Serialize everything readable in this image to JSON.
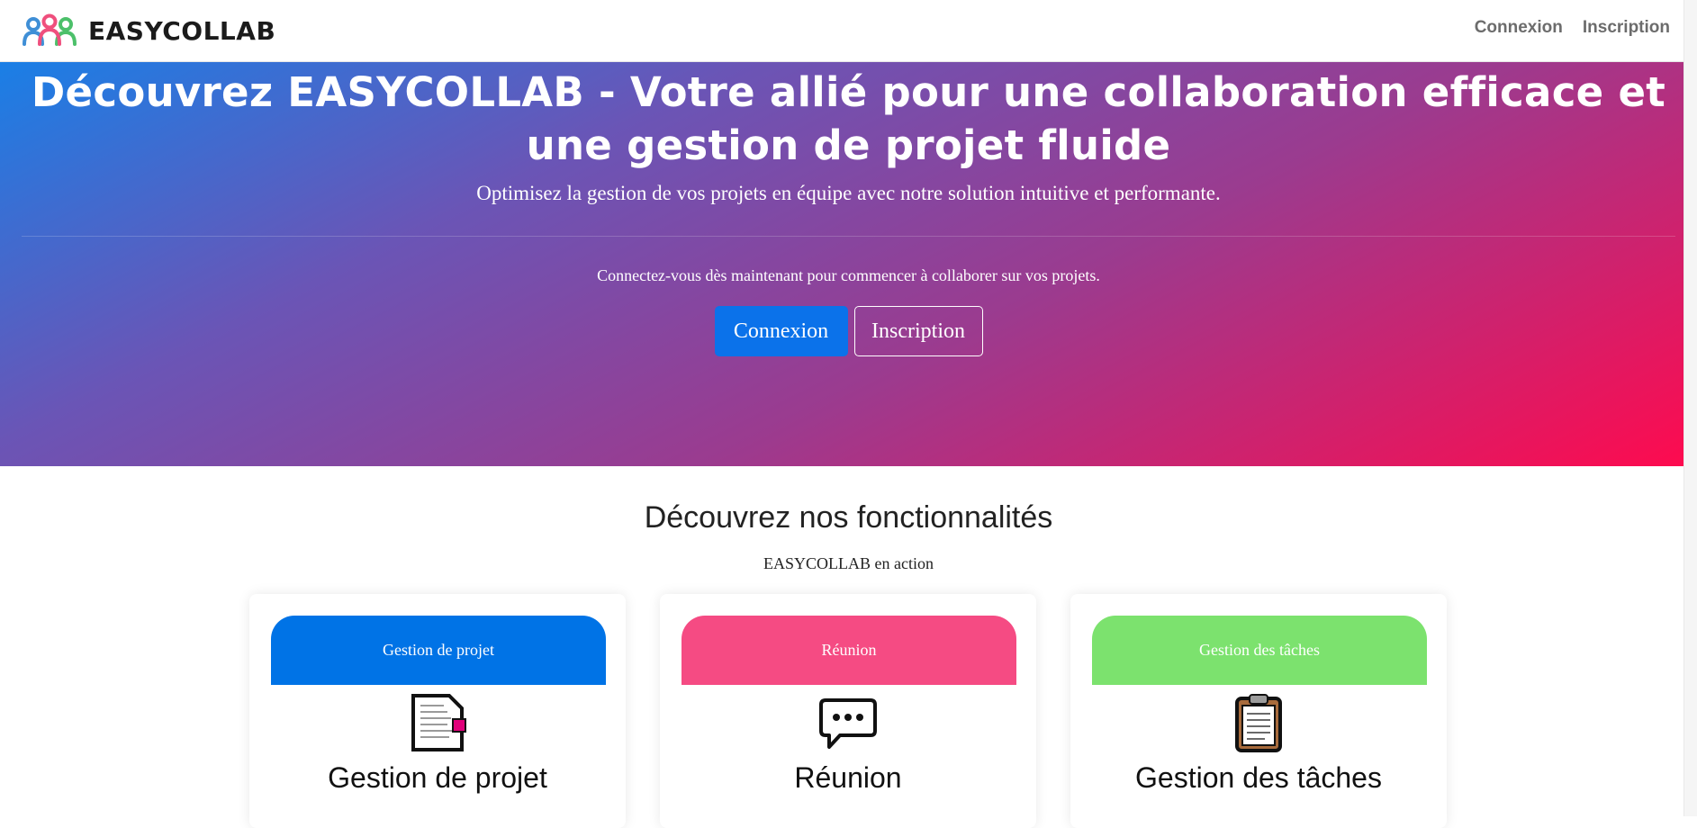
{
  "navbar": {
    "brand": "EASYCOLLAB",
    "logo_icon": "team-people-icon",
    "links": [
      "Connexion",
      "Inscription"
    ]
  },
  "hero": {
    "title": "Découvrez EASYCOLLAB - Votre allié pour une collaboration efficace et une gestion de projet fluide",
    "subtitle": "Optimisez la gestion de vos projets en équipe avec notre solution intuitive et performante.",
    "cta_text": "Connectez-vous dès maintenant pour commencer à collaborer sur vos projets.",
    "login_button": "Connexion",
    "signup_button": "Inscription",
    "gradient": [
      "#1a7fe6",
      "#6a55b6",
      "#9b3b8f",
      "#ff0a4e"
    ]
  },
  "features": {
    "title": "Découvrez nos fonctionnalités",
    "subtitle": "EASYCOLLAB en action",
    "cards": [
      {
        "header": "Gestion de projet",
        "title": "Gestion de projet",
        "icon": "document-icon",
        "color": "#0073e6"
      },
      {
        "header": "Réunion",
        "title": "Réunion",
        "icon": "speech-bubble-icon",
        "color": "#f54b83"
      },
      {
        "header": "Gestion des tâches",
        "title": "Gestion des tâches",
        "icon": "clipboard-icon",
        "color": "#7ce26e"
      }
    ]
  },
  "colors": {
    "primary_button": "#0b72ea",
    "nav_link": "#6c6c6c"
  }
}
